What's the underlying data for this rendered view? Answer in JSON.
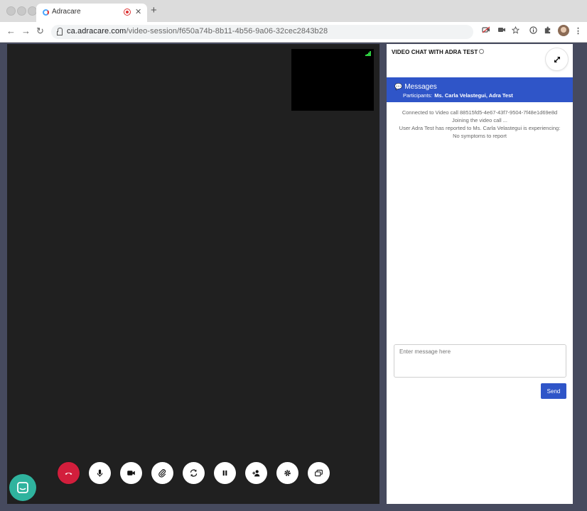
{
  "browser": {
    "tab_title": "Adracare",
    "tab_close": "✕",
    "new_tab": "+",
    "url_host": "ca.adracare.com",
    "url_path": "/video-session/f650a74b-8b11-4b56-9a06-32cec2843b28",
    "back": "←",
    "forward": "→",
    "reload": "↻"
  },
  "chat": {
    "title": "VIDEO CHAT WITH ADRA TEST",
    "messages_title": "Messages",
    "participants_label": "Participants:",
    "participants": "Ms. Carla Velastegui, Adra Test",
    "log": [
      "Connected to Video call 88515fd5-4e67-43f7-9504-7f48e1d69e8d",
      "Joining the video call ...",
      "User Adra Test has reported to Ms. Carla Velastegui is experiencing:",
      "No symptoms to report"
    ],
    "input_placeholder": "Enter message here",
    "send_label": "Send"
  },
  "controls": [
    {
      "name": "end-call-button",
      "icon": "phone-hangup-icon"
    },
    {
      "name": "microphone-button",
      "icon": "microphone-icon"
    },
    {
      "name": "camera-button",
      "icon": "video-camera-icon"
    },
    {
      "name": "attach-button",
      "icon": "paperclip-icon"
    },
    {
      "name": "switch-camera-button",
      "icon": "sync-icon"
    },
    {
      "name": "pause-button",
      "icon": "pause-icon"
    },
    {
      "name": "add-participant-button",
      "icon": "add-user-icon"
    },
    {
      "name": "settings-button",
      "icon": "gear-icon"
    },
    {
      "name": "screen-share-button",
      "icon": "windows-icon"
    }
  ],
  "colors": {
    "accent": "#2f55c8",
    "end_call": "#d21e3c",
    "app_background": "#464a5e",
    "video_background": "#202020",
    "launcher": "#2fb39e"
  }
}
